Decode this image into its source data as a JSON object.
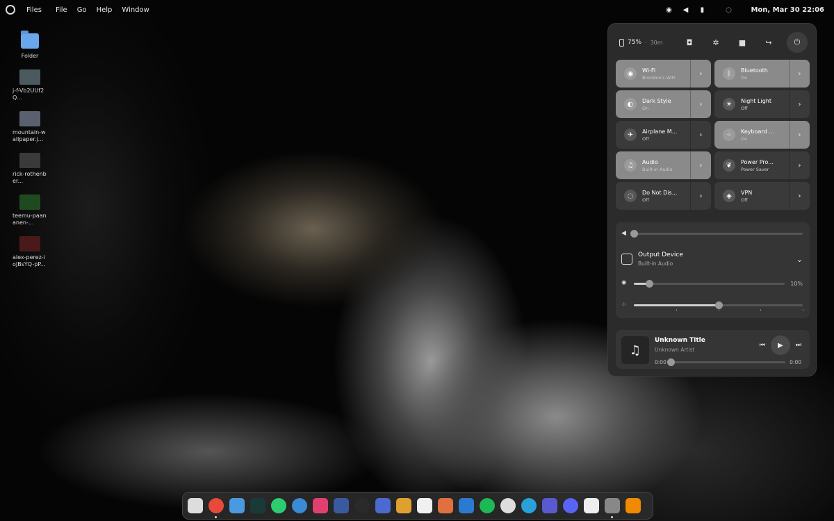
{
  "topbar": {
    "app_name": "Files",
    "menus": [
      "File",
      "Go",
      "Help",
      "Window"
    ],
    "clock": "Mon, Mar 30  22:06"
  },
  "desktop": [
    {
      "label": "Folder",
      "kind": "folder"
    },
    {
      "label": "j-f-Vb2UUf2Q...",
      "kind": "image",
      "color": "#4a5a5e"
    },
    {
      "label": "mountain-wallpaper.j...",
      "kind": "image",
      "color": "#5a6070"
    },
    {
      "label": "rick-rothenber...",
      "kind": "image",
      "color": "#3a3a3a"
    },
    {
      "label": "teemu-paananen-...",
      "kind": "image",
      "color": "#1f4a1f"
    },
    {
      "label": "alex-perez-ioJBsYQ-pP...",
      "kind": "image",
      "color": "#4a1a1a"
    }
  ],
  "panel": {
    "battery": "75%",
    "battery_time": "30m",
    "tiles": [
      {
        "title": "Wi-Fi",
        "sub": "Brombin's WiFi",
        "on": true,
        "icon": "wifi-icon",
        "glyph": "◉"
      },
      {
        "title": "Bluetooth",
        "sub": "On",
        "on": true,
        "icon": "bluetooth-icon",
        "glyph": "ᛒ"
      },
      {
        "title": "Dark Style",
        "sub": "On",
        "on": true,
        "icon": "dark-style-icon",
        "glyph": "◐"
      },
      {
        "title": "Night Light",
        "sub": "Off",
        "on": false,
        "icon": "night-light-icon",
        "glyph": "☀"
      },
      {
        "title": "Airplane M...",
        "sub": "Off",
        "on": false,
        "icon": "airplane-icon",
        "glyph": "✈"
      },
      {
        "title": "Keyboard ...",
        "sub": "On",
        "on": true,
        "icon": "keyboard-light-icon",
        "glyph": "⁘"
      },
      {
        "title": "Audio",
        "sub": "Built-in Audio",
        "on": true,
        "icon": "audio-icon",
        "glyph": "♫"
      },
      {
        "title": "Power Pro...",
        "sub": "Power Saver",
        "on": false,
        "icon": "leaf-icon",
        "glyph": "❦"
      },
      {
        "title": "Do Not Dis...",
        "sub": "Off",
        "on": false,
        "icon": "bell-icon",
        "glyph": "◌"
      },
      {
        "title": "VPN",
        "sub": "Off",
        "on": false,
        "icon": "shield-icon",
        "glyph": "◈"
      }
    ],
    "volume_level": 0,
    "output_device_title": "Output Device",
    "output_device_sub": "Built-in Audio",
    "brightness_value": "10%",
    "brightness_level": 0.1,
    "keyboard_light_level": 0.5,
    "media": {
      "title": "Unknown Title",
      "artist": "Unknown Artist",
      "time_start": "0:00",
      "time_end": "0:00"
    }
  },
  "dock": [
    {
      "name": "sidebar-app",
      "color": "#dddddd",
      "dot": false
    },
    {
      "name": "chrome-app",
      "color": "#e84a3a",
      "dot": true
    },
    {
      "name": "files-app",
      "color": "#4a9ae0",
      "dot": false
    },
    {
      "name": "terminal-app",
      "color": "#1a3a3a",
      "dot": false
    },
    {
      "name": "whatsapp-app",
      "color": "#2ecc71",
      "dot": false
    },
    {
      "name": "browser-app",
      "color": "#3a8ad6",
      "dot": false
    },
    {
      "name": "camera-app",
      "color": "#e04070",
      "dot": false
    },
    {
      "name": "calculator-app",
      "color": "#3a5aa0",
      "dot": false
    },
    {
      "name": "monitor-app",
      "color": "#2a2a2a",
      "dot": false
    },
    {
      "name": "store-app",
      "color": "#4a6ad0",
      "dot": false
    },
    {
      "name": "pencil-app",
      "color": "#e0a030",
      "dot": false
    },
    {
      "name": "notes-app",
      "color": "#f0f0f0",
      "dot": false
    },
    {
      "name": "paint-app",
      "color": "#e07040",
      "dot": false
    },
    {
      "name": "vscode-app",
      "color": "#2a7ad0",
      "dot": false
    },
    {
      "name": "spotify-app",
      "color": "#1db954",
      "dot": false
    },
    {
      "name": "disk-app",
      "color": "#dddddd",
      "dot": false
    },
    {
      "name": "telegram-app",
      "color": "#2aa0da",
      "dot": false
    },
    {
      "name": "teams-app",
      "color": "#5a5ad0",
      "dot": false
    },
    {
      "name": "discord-app",
      "color": "#5865f2",
      "dot": false
    },
    {
      "name": "toggle-app",
      "color": "#eeeeee",
      "dot": false
    },
    {
      "name": "panels-app",
      "color": "#888888",
      "dot": true
    },
    {
      "name": "vlc-app",
      "color": "#f08a00",
      "dot": false
    }
  ]
}
